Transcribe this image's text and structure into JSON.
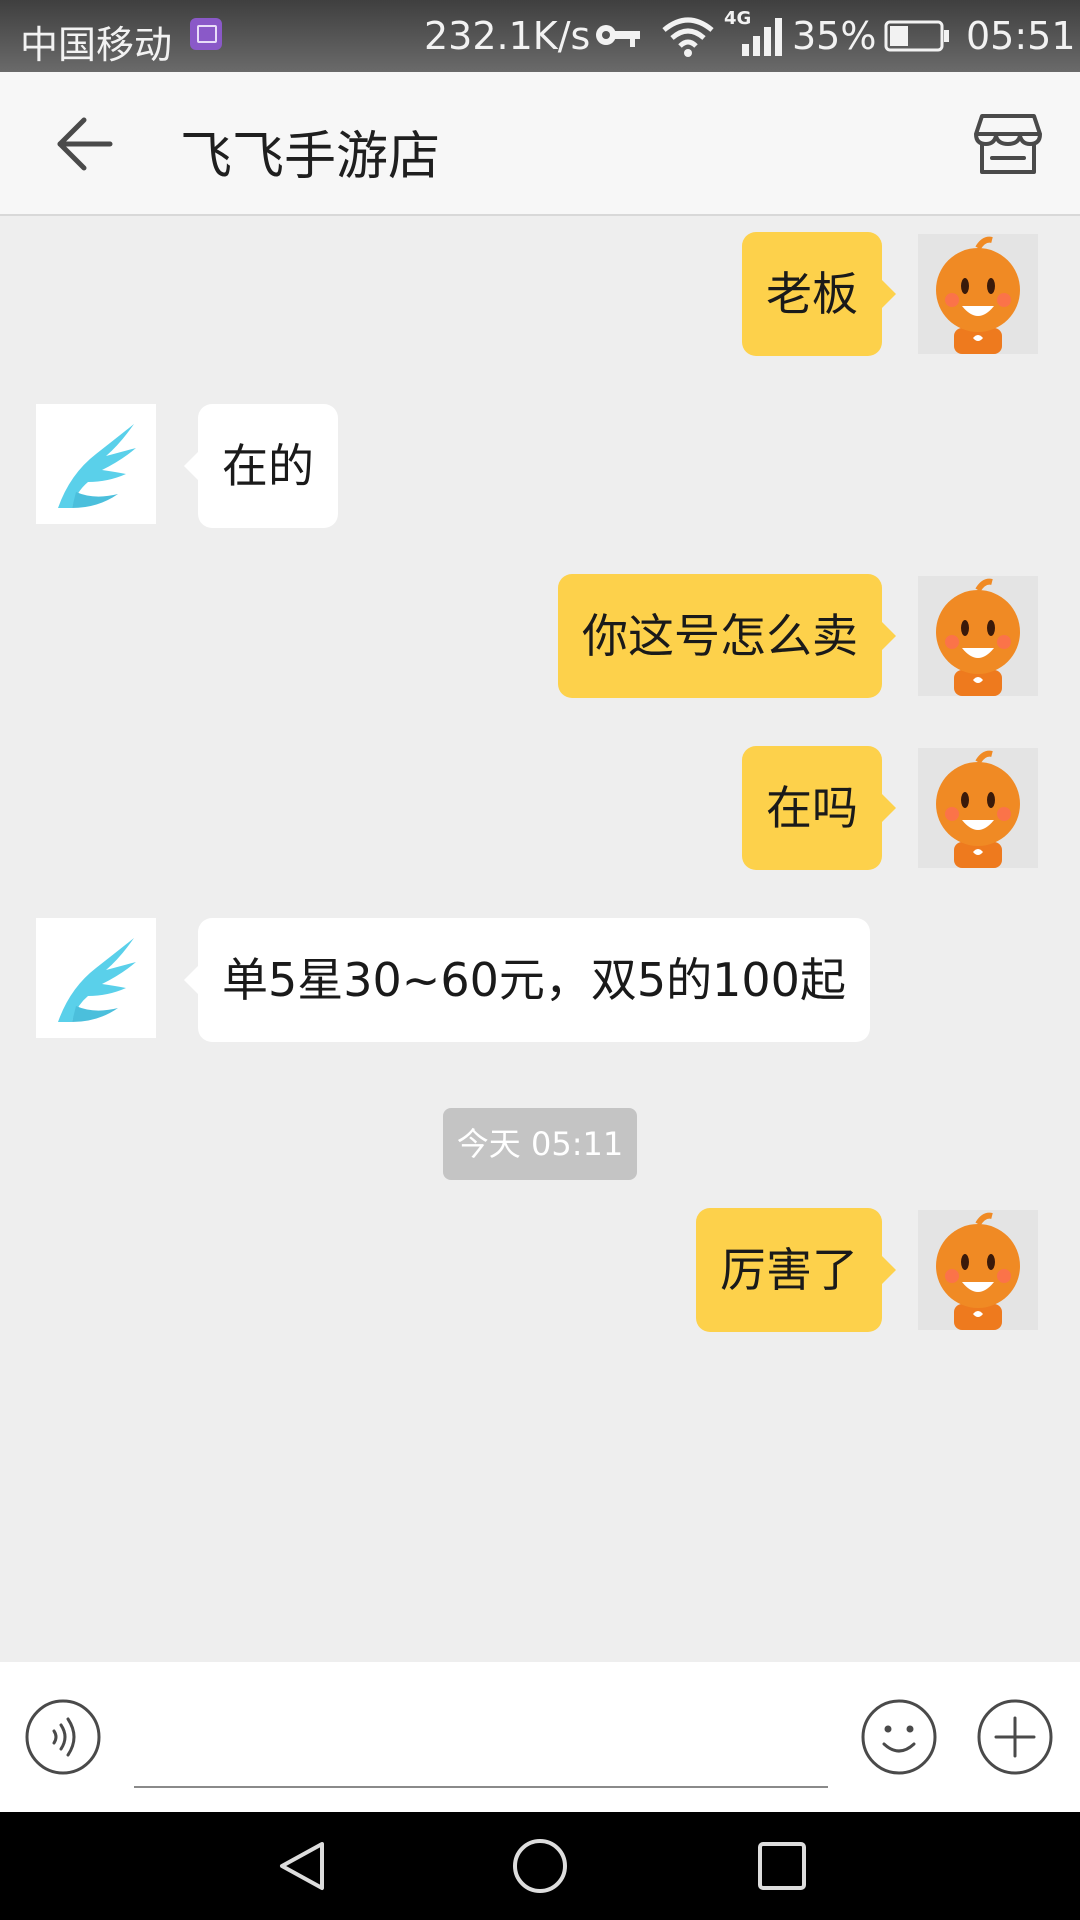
{
  "status_bar": {
    "carrier": "中国移动",
    "net_speed": "232.1K/s",
    "network_type": "4G",
    "battery": "35%",
    "time": "05:51",
    "icons": [
      "sim-card-icon",
      "key-icon",
      "wifi-icon",
      "signal-icon",
      "battery-icon"
    ]
  },
  "header": {
    "title": "飞飞手游店",
    "back_icon": "arrow-left-icon",
    "shop_icon": "storefront-icon"
  },
  "messages": [
    {
      "from": "me",
      "text": "老板"
    },
    {
      "from": "shop",
      "text": "在的"
    },
    {
      "from": "me",
      "text": "你这号怎么卖"
    },
    {
      "from": "me",
      "text": "在吗"
    },
    {
      "from": "shop",
      "text": "单5星30~60元，双5的100起"
    },
    {
      "from": "me",
      "text": "厉害了"
    }
  ],
  "timestamp": "今天 05:11",
  "input_bar": {
    "placeholder": "",
    "voice_icon": "voice-icon",
    "emoji_icon": "emoji-icon",
    "more_icon": "plus-icon"
  },
  "colors": {
    "my_bubble": "#fdd14b",
    "their_bubble": "#ffffff",
    "chat_background": "#eeeeee"
  }
}
